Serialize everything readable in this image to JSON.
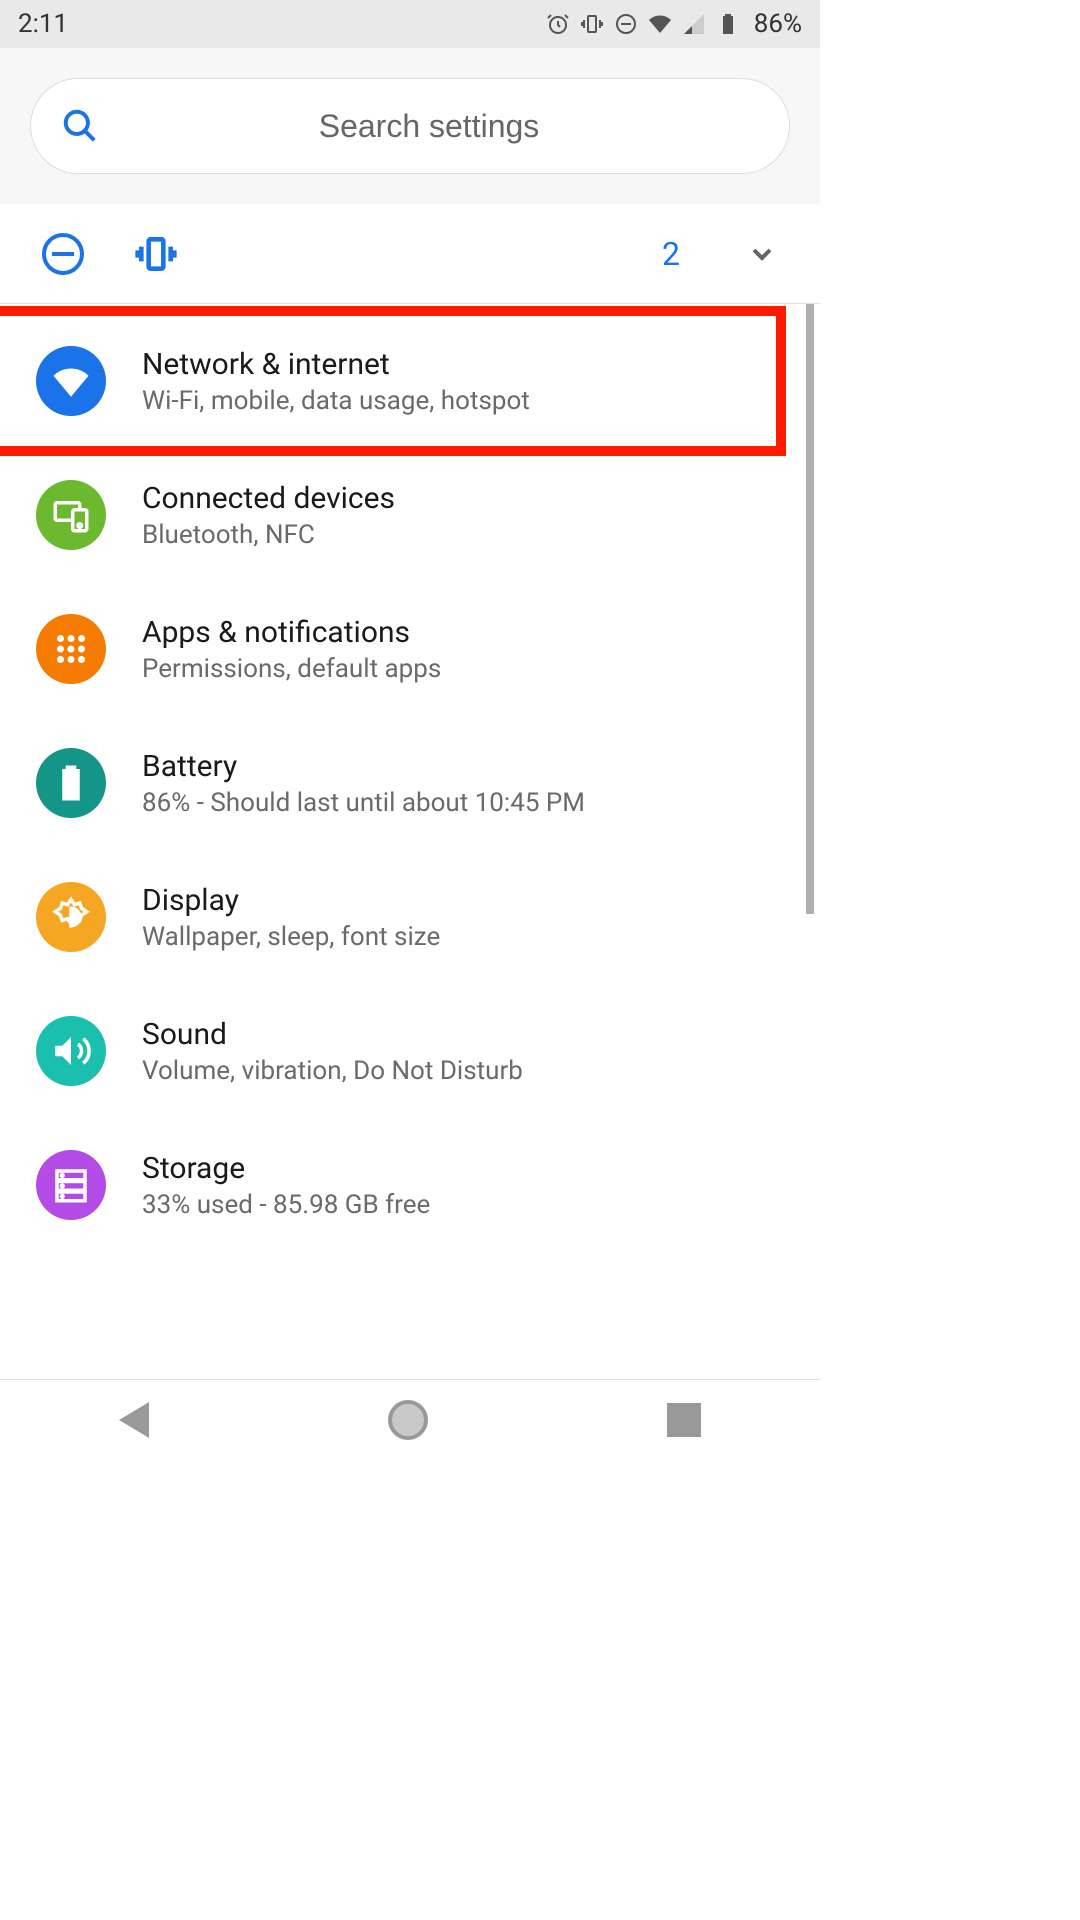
{
  "status": {
    "time": "2:11",
    "battery_text": "86%"
  },
  "search": {
    "placeholder": "Search settings"
  },
  "suggestions": {
    "count": "2"
  },
  "items": [
    {
      "title": "Network & internet",
      "subtitle": "Wi-Fi, mobile, data usage, hotspot",
      "color": "#1a73e8",
      "icon": "wifi",
      "highlighted": true
    },
    {
      "title": "Connected devices",
      "subtitle": "Bluetooth, NFC",
      "color": "#6cb92f",
      "icon": "devices"
    },
    {
      "title": "Apps & notifications",
      "subtitle": "Permissions, default apps",
      "color": "#f57c00",
      "icon": "apps"
    },
    {
      "title": "Battery",
      "subtitle": "86% - Should last until about 10:45 PM",
      "color": "#159488",
      "icon": "battery"
    },
    {
      "title": "Display",
      "subtitle": "Wallpaper, sleep, font size",
      "color": "#f5a623",
      "icon": "display"
    },
    {
      "title": "Sound",
      "subtitle": "Volume, vibration, Do Not Disturb",
      "color": "#1abfad",
      "icon": "sound"
    },
    {
      "title": "Storage",
      "subtitle": "33% used - 85.98 GB free",
      "color": "#b34be6",
      "icon": "storage"
    }
  ]
}
